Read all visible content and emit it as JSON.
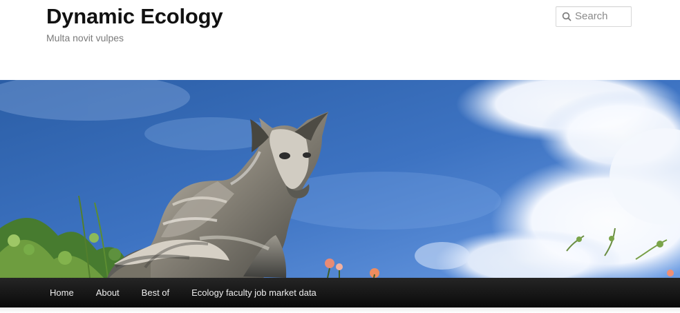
{
  "site": {
    "title": "Dynamic Ecology",
    "tagline": "Multa novit vulpes"
  },
  "search": {
    "placeholder": "Search",
    "value": "",
    "icon": "search-icon"
  },
  "banner": {
    "subject": "fox-statue",
    "icons": [
      "cloud-icon",
      "flower-icon",
      "leaf-icon"
    ]
  },
  "navigation": {
    "items": [
      {
        "label": "Home"
      },
      {
        "label": "About"
      },
      {
        "label": "Best of"
      },
      {
        "label": "Ecology faculty job market data"
      }
    ]
  },
  "colors": {
    "header_background": "#ffffff",
    "title": "#111111",
    "tagline": "#7a7a7a",
    "nav_background": "#111111",
    "nav_text": "#eeeeee",
    "sky": "#3f77c4"
  }
}
